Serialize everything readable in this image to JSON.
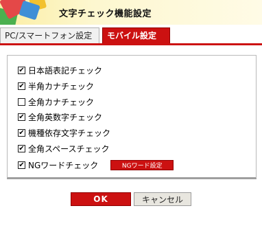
{
  "window": {
    "title": "文字チェック機能設定"
  },
  "tabs": [
    {
      "label": "PC/スマートフォン設定",
      "active": false
    },
    {
      "label": "モバイル設定",
      "active": true
    }
  ],
  "checks": [
    {
      "label": "日本語表記チェック",
      "checked": true,
      "mark": "✔"
    },
    {
      "label": "半角カナチェック",
      "checked": true,
      "mark": "✔"
    },
    {
      "label": "全角カナチェック",
      "checked": false,
      "mark": ""
    },
    {
      "label": "全角英数字チェック",
      "checked": true,
      "mark": "✔"
    },
    {
      "label": "機種依存文字チェック",
      "checked": true,
      "mark": "✔"
    },
    {
      "label": "全角スペースチェック",
      "checked": true,
      "mark": "✔"
    },
    {
      "label": "NGワードチェック",
      "checked": true,
      "mark": "✔"
    }
  ],
  "ng_settings_label": "NGワード設定",
  "footer": {
    "ok_label": "OK",
    "cancel_label": "キャンセル"
  },
  "colors": {
    "accent": "#cc1111",
    "title_bg": "#fbeea4"
  }
}
